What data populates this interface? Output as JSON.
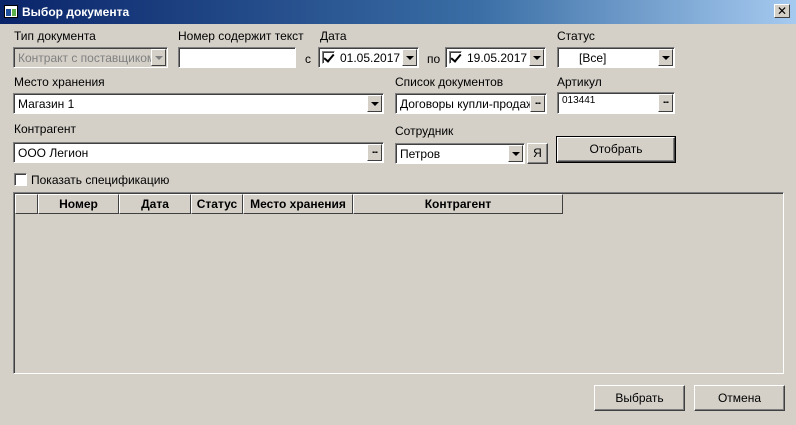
{
  "window": {
    "title": "Выбор документа",
    "close_glyph": "✕"
  },
  "filters": {
    "doc_type": {
      "label": "Тип документа",
      "value": "Контракт с поставщиком"
    },
    "number_contains": {
      "label": "Номер содержит текст",
      "value": ""
    },
    "date": {
      "label": "Дата",
      "from_prefix": "с",
      "from_value": "01.05.2017",
      "from_checked": true,
      "to_prefix": "по",
      "to_value": "19.05.2017",
      "to_checked": true
    },
    "status": {
      "label": "Статус",
      "value": "[Все]"
    },
    "storage": {
      "label": "Место хранения",
      "value": "Магазин 1"
    },
    "doc_list": {
      "label": "Список документов",
      "value": "Договоры купли-продажи"
    },
    "article": {
      "label": "Артикул",
      "value": "013441"
    },
    "counterparty": {
      "label": "Контрагент",
      "value": "ООО Легион"
    },
    "employee": {
      "label": "Сотрудник",
      "value": "Петров",
      "me_button": "Я"
    },
    "show_spec": {
      "label": "Показать спецификацию",
      "checked": false
    }
  },
  "actions": {
    "select_filter": "Отобрать",
    "choose": "Выбрать",
    "cancel": "Отмена"
  },
  "table": {
    "columns": [
      "",
      "Номер",
      "Дата",
      "Статус",
      "Место хранения",
      "Контрагент"
    ],
    "rows": []
  },
  "icons": {
    "ellipsis": "...",
    "dropdown": "chevron-down-icon"
  }
}
